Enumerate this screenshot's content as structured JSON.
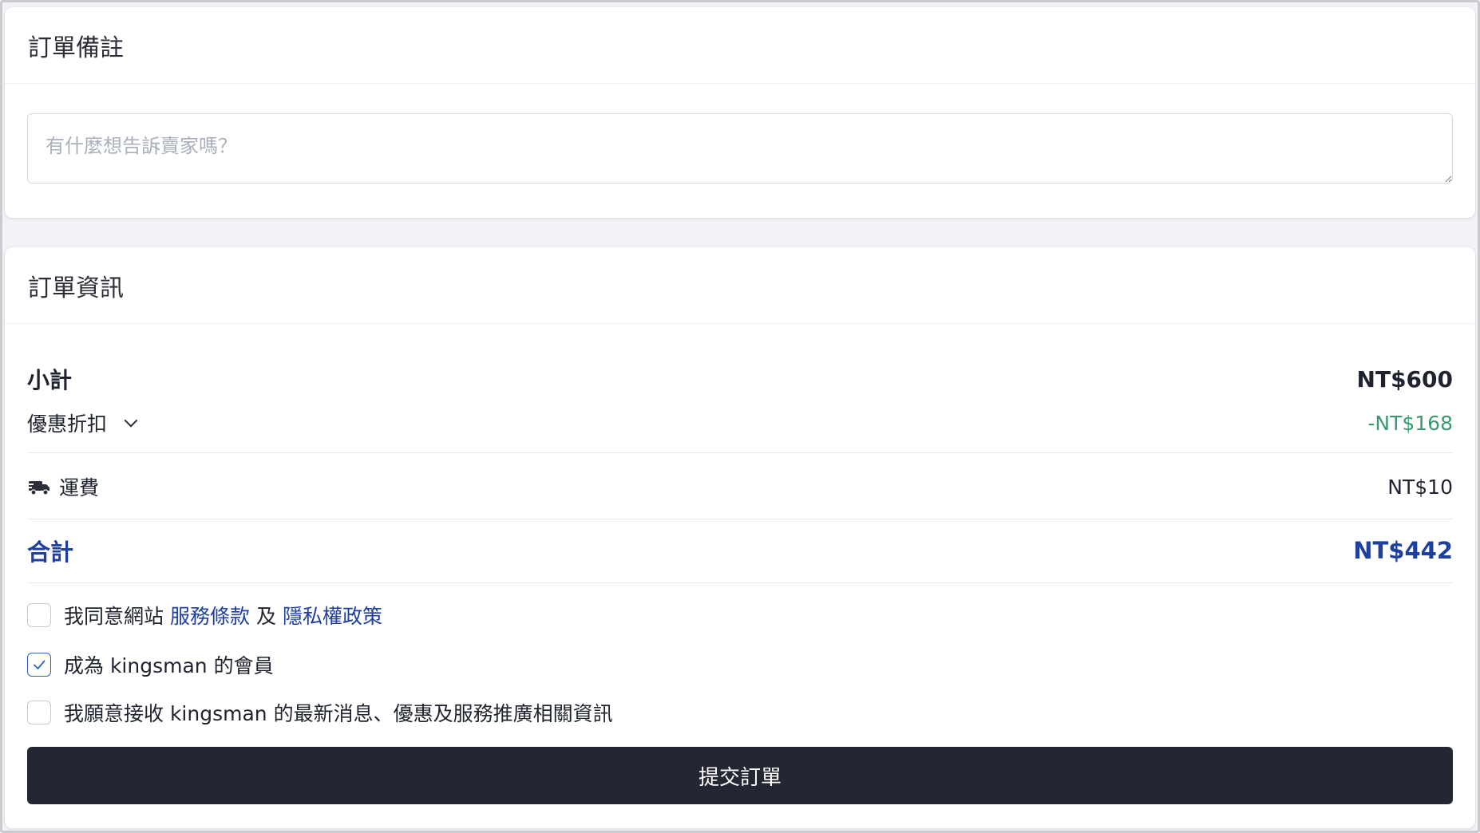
{
  "notes": {
    "title": "訂單備註",
    "placeholder": "有什麼想告訴賣家嗎？",
    "value": ""
  },
  "order_info": {
    "title": "訂單資訊",
    "subtotal": {
      "label": "小計",
      "amount": "NT$600"
    },
    "discount": {
      "label": "優惠折扣",
      "amount": "-NT$168",
      "icon": "chevron-down-icon",
      "color": "#3a9a6e"
    },
    "shipping": {
      "label": "運費",
      "amount": "NT$10",
      "icon": "truck-icon"
    },
    "total": {
      "label": "合計",
      "amount": "NT$442",
      "color": "#1e3f9e"
    }
  },
  "agreements": {
    "terms": {
      "checked": false,
      "prefix": "我同意網站",
      "terms_link": "服務條款",
      "joiner": "及",
      "privacy_link": "隱私權政策"
    },
    "membership": {
      "checked": true,
      "label": "成為 kingsman 的會員"
    },
    "newsletter": {
      "checked": false,
      "label": "我願意接收 kingsman 的最新消息、優惠及服務推廣相關資訊"
    }
  },
  "submit": {
    "label": "提交訂單",
    "color": "#242733"
  }
}
